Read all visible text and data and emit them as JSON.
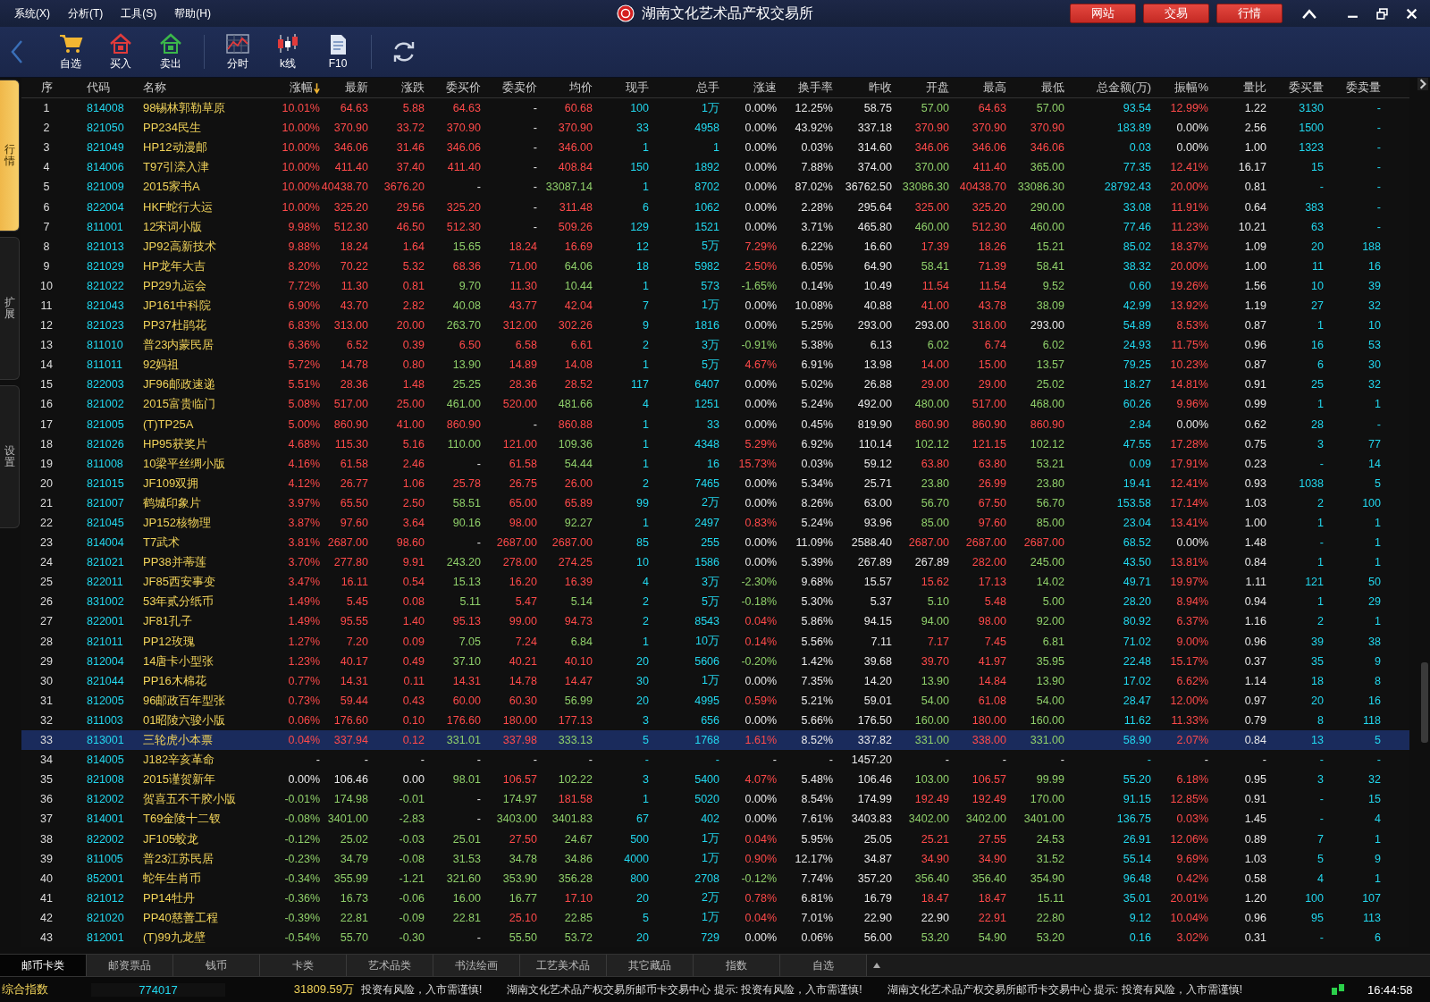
{
  "menu": [
    "系统(X)",
    "分析(T)",
    "工具(S)",
    "帮助(H)"
  ],
  "window": {
    "title": "湖南文化艺术品产权交易所",
    "buttons": [
      "网站",
      "交易",
      "行情"
    ]
  },
  "toolbar": [
    {
      "kind": "cart",
      "label": "自选"
    },
    {
      "kind": "buy",
      "label": "买入"
    },
    {
      "kind": "sell",
      "label": "卖出"
    },
    {
      "kind": "timeshare",
      "label": "分时"
    },
    {
      "kind": "kline",
      "label": "k线"
    },
    {
      "kind": "doc",
      "label": "F10"
    }
  ],
  "side_tabs": [
    {
      "label": "行情",
      "selected": true
    },
    {
      "label": "扩展",
      "selected": false
    },
    {
      "label": "设置",
      "selected": false
    }
  ],
  "table": {
    "columns": [
      {
        "label": "序",
        "kind": "seq",
        "sorted": false
      },
      {
        "label": "代码",
        "kind": "code",
        "sorted": false
      },
      {
        "label": "名称",
        "kind": "name",
        "sorted": false
      },
      {
        "label": "涨幅",
        "kind": "change",
        "sorted": true
      },
      {
        "label": "最新",
        "kind": "price",
        "sorted": false
      },
      {
        "label": "涨跌",
        "kind": "change",
        "sorted": false
      },
      {
        "label": "委买价",
        "kind": "price",
        "sorted": false
      },
      {
        "label": "委卖价",
        "kind": "price",
        "sorted": false
      },
      {
        "label": "均价",
        "kind": "price",
        "sorted": false
      },
      {
        "label": "现手",
        "kind": "volume",
        "sorted": false
      },
      {
        "label": "总手",
        "kind": "volume",
        "sorted": false
      },
      {
        "label": "涨速",
        "kind": "change",
        "sorted": false
      },
      {
        "label": "换手率",
        "kind": "plain",
        "sorted": false
      },
      {
        "label": "昨收",
        "kind": "prev_close",
        "sorted": false
      },
      {
        "label": "开盘",
        "kind": "price",
        "sorted": false
      },
      {
        "label": "最高",
        "kind": "price",
        "sorted": false
      },
      {
        "label": "最低",
        "kind": "price",
        "sorted": false
      },
      {
        "label": "总金额(万)",
        "kind": "volume",
        "sorted": false
      },
      {
        "label": "振幅%",
        "kind": "amplitude",
        "sorted": false
      },
      {
        "label": "量比",
        "kind": "plain",
        "sorted": false
      },
      {
        "label": "委买量",
        "kind": "volume",
        "sorted": false
      },
      {
        "label": "委卖量",
        "kind": "volume",
        "sorted": false
      }
    ],
    "rows": [
      {
        "selected": false,
        "cells": [
          "1",
          "814008",
          "98锡林郭勒草原",
          "10.01%",
          "64.63",
          "5.88",
          "64.63",
          "-",
          "60.68",
          "100",
          "1万",
          "0.00%",
          "12.25%",
          "58.75",
          "57.00",
          "64.63",
          "57.00",
          "93.54",
          "12.99%",
          "1.22",
          "3130",
          "-"
        ]
      },
      {
        "selected": false,
        "cells": [
          "2",
          "821050",
          "PP234民生",
          "10.00%",
          "370.90",
          "33.72",
          "370.90",
          "-",
          "370.90",
          "33",
          "4958",
          "0.00%",
          "43.92%",
          "337.18",
          "370.90",
          "370.90",
          "370.90",
          "183.89",
          "0.00%",
          "2.56",
          "1500",
          "-"
        ]
      },
      {
        "selected": false,
        "cells": [
          "3",
          "821049",
          "HP12动漫邮",
          "10.00%",
          "346.06",
          "31.46",
          "346.06",
          "-",
          "346.00",
          "1",
          "1",
          "0.00%",
          "0.03%",
          "314.60",
          "346.06",
          "346.06",
          "346.06",
          "0.03",
          "0.00%",
          "1.00",
          "1323",
          "-"
        ]
      },
      {
        "selected": false,
        "cells": [
          "4",
          "814006",
          "T97引滦入津",
          "10.00%",
          "411.40",
          "37.40",
          "411.40",
          "-",
          "408.84",
          "150",
          "1892",
          "0.00%",
          "7.88%",
          "374.00",
          "370.00",
          "411.40",
          "365.00",
          "77.35",
          "12.41%",
          "16.17",
          "15",
          "-"
        ]
      },
      {
        "selected": false,
        "cells": [
          "5",
          "821009",
          "2015家书A",
          "10.00%",
          "40438.70",
          "3676.20",
          "-",
          "-",
          "33087.14",
          "1",
          "8702",
          "0.00%",
          "87.02%",
          "36762.50",
          "33086.30",
          "40438.70",
          "33086.30",
          "28792.43",
          "20.00%",
          "0.81",
          "-",
          "-"
        ]
      },
      {
        "selected": false,
        "cells": [
          "6",
          "822004",
          "HKF蛇行大运",
          "10.00%",
          "325.20",
          "29.56",
          "325.20",
          "-",
          "311.48",
          "6",
          "1062",
          "0.00%",
          "2.28%",
          "295.64",
          "325.00",
          "325.20",
          "290.00",
          "33.08",
          "11.91%",
          "0.64",
          "383",
          "-"
        ]
      },
      {
        "selected": false,
        "cells": [
          "7",
          "811001",
          "12宋词小版",
          "9.98%",
          "512.30",
          "46.50",
          "512.30",
          "-",
          "509.26",
          "129",
          "1521",
          "0.00%",
          "3.71%",
          "465.80",
          "460.00",
          "512.30",
          "460.00",
          "77.46",
          "11.23%",
          "10.21",
          "63",
          "-"
        ]
      },
      {
        "selected": false,
        "cells": [
          "8",
          "821013",
          "JP92高新技术",
          "9.88%",
          "18.24",
          "1.64",
          "15.65",
          "18.24",
          "16.69",
          "12",
          "5万",
          "7.29%",
          "6.22%",
          "16.60",
          "17.39",
          "18.26",
          "15.21",
          "85.02",
          "18.37%",
          "1.09",
          "20",
          "188"
        ]
      },
      {
        "selected": false,
        "cells": [
          "9",
          "821029",
          "HP龙年大吉",
          "8.20%",
          "70.22",
          "5.32",
          "68.36",
          "71.00",
          "64.06",
          "18",
          "5982",
          "2.50%",
          "6.05%",
          "64.90",
          "58.41",
          "71.39",
          "58.41",
          "38.32",
          "20.00%",
          "1.00",
          "11",
          "16"
        ]
      },
      {
        "selected": false,
        "cells": [
          "10",
          "821022",
          "PP29九运会",
          "7.72%",
          "11.30",
          "0.81",
          "9.70",
          "11.30",
          "10.44",
          "1",
          "573",
          "-1.65%",
          "0.14%",
          "10.49",
          "11.54",
          "11.54",
          "9.52",
          "0.60",
          "19.26%",
          "1.56",
          "10",
          "39"
        ]
      },
      {
        "selected": false,
        "cells": [
          "11",
          "821043",
          "JP161中科院",
          "6.90%",
          "43.70",
          "2.82",
          "40.08",
          "43.77",
          "42.04",
          "7",
          "1万",
          "0.00%",
          "10.08%",
          "40.88",
          "41.00",
          "43.78",
          "38.09",
          "42.99",
          "13.92%",
          "1.19",
          "27",
          "32"
        ]
      },
      {
        "selected": false,
        "cells": [
          "12",
          "821023",
          "PP37杜鹃花",
          "6.83%",
          "313.00",
          "20.00",
          "263.70",
          "312.00",
          "302.26",
          "9",
          "1816",
          "0.00%",
          "5.25%",
          "293.00",
          "293.00",
          "318.00",
          "293.00",
          "54.89",
          "8.53%",
          "0.87",
          "1",
          "10"
        ]
      },
      {
        "selected": false,
        "cells": [
          "13",
          "811010",
          "普23内蒙民居",
          "6.36%",
          "6.52",
          "0.39",
          "6.50",
          "6.58",
          "6.61",
          "2",
          "3万",
          "-0.91%",
          "5.38%",
          "6.13",
          "6.02",
          "6.74",
          "6.02",
          "24.93",
          "11.75%",
          "0.96",
          "16",
          "53"
        ]
      },
      {
        "selected": false,
        "cells": [
          "14",
          "811011",
          "92妈祖",
          "5.72%",
          "14.78",
          "0.80",
          "13.90",
          "14.89",
          "14.08",
          "1",
          "5万",
          "4.67%",
          "6.91%",
          "13.98",
          "14.00",
          "15.00",
          "13.57",
          "79.25",
          "10.23%",
          "0.87",
          "6",
          "30"
        ]
      },
      {
        "selected": false,
        "cells": [
          "15",
          "822003",
          "JF96邮政速递",
          "5.51%",
          "28.36",
          "1.48",
          "25.25",
          "28.36",
          "28.52",
          "117",
          "6407",
          "0.00%",
          "5.02%",
          "26.88",
          "29.00",
          "29.00",
          "25.02",
          "18.27",
          "14.81%",
          "0.91",
          "25",
          "32"
        ]
      },
      {
        "selected": false,
        "cells": [
          "16",
          "821002",
          "2015富贵临门",
          "5.08%",
          "517.00",
          "25.00",
          "461.00",
          "520.00",
          "481.66",
          "4",
          "1251",
          "0.00%",
          "5.24%",
          "492.00",
          "480.00",
          "517.00",
          "468.00",
          "60.26",
          "9.96%",
          "0.99",
          "1",
          "1"
        ]
      },
      {
        "selected": false,
        "cells": [
          "17",
          "821005",
          "(T)TP25A",
          "5.00%",
          "860.90",
          "41.00",
          "860.90",
          "-",
          "860.88",
          "1",
          "33",
          "0.00%",
          "0.45%",
          "819.90",
          "860.90",
          "860.90",
          "860.90",
          "2.84",
          "0.00%",
          "0.62",
          "28",
          "-"
        ]
      },
      {
        "selected": false,
        "cells": [
          "18",
          "821026",
          "HP95获奖片",
          "4.68%",
          "115.30",
          "5.16",
          "110.00",
          "121.00",
          "109.36",
          "1",
          "4348",
          "5.29%",
          "6.92%",
          "110.14",
          "102.12",
          "121.15",
          "102.12",
          "47.55",
          "17.28%",
          "0.75",
          "3",
          "77"
        ]
      },
      {
        "selected": false,
        "cells": [
          "19",
          "811008",
          "10梁平丝绸小版",
          "4.16%",
          "61.58",
          "2.46",
          "-",
          "61.58",
          "54.44",
          "1",
          "16",
          "15.73%",
          "0.03%",
          "59.12",
          "63.80",
          "63.80",
          "53.21",
          "0.09",
          "17.91%",
          "0.23",
          "-",
          "14"
        ]
      },
      {
        "selected": false,
        "cells": [
          "20",
          "821015",
          "JF109双拥",
          "4.12%",
          "26.77",
          "1.06",
          "25.78",
          "26.75",
          "26.00",
          "2",
          "7465",
          "0.00%",
          "5.34%",
          "25.71",
          "23.80",
          "26.99",
          "23.80",
          "19.41",
          "12.41%",
          "0.93",
          "1038",
          "5"
        ]
      },
      {
        "selected": false,
        "cells": [
          "21",
          "821007",
          "鹤城印象片",
          "3.97%",
          "65.50",
          "2.50",
          "58.51",
          "65.00",
          "65.89",
          "99",
          "2万",
          "0.00%",
          "8.26%",
          "63.00",
          "56.70",
          "67.50",
          "56.70",
          "153.58",
          "17.14%",
          "1.03",
          "2",
          "100"
        ]
      },
      {
        "selected": false,
        "cells": [
          "22",
          "821045",
          "JP152核物理",
          "3.87%",
          "97.60",
          "3.64",
          "90.16",
          "98.00",
          "92.27",
          "1",
          "2497",
          "0.83%",
          "5.24%",
          "93.96",
          "85.00",
          "97.60",
          "85.00",
          "23.04",
          "13.41%",
          "1.00",
          "1",
          "1"
        ]
      },
      {
        "selected": false,
        "cells": [
          "23",
          "814004",
          "T7武术",
          "3.81%",
          "2687.00",
          "98.60",
          "-",
          "2687.00",
          "2687.00",
          "85",
          "255",
          "0.00%",
          "11.09%",
          "2588.40",
          "2687.00",
          "2687.00",
          "2687.00",
          "68.52",
          "0.00%",
          "1.48",
          "-",
          "1"
        ]
      },
      {
        "selected": false,
        "cells": [
          "24",
          "821021",
          "PP38并蒂莲",
          "3.70%",
          "277.80",
          "9.91",
          "243.20",
          "278.00",
          "274.25",
          "10",
          "1586",
          "0.00%",
          "5.39%",
          "267.89",
          "267.89",
          "282.00",
          "245.00",
          "43.50",
          "13.81%",
          "0.84",
          "1",
          "1"
        ]
      },
      {
        "selected": false,
        "cells": [
          "25",
          "822011",
          "JF85西安事变",
          "3.47%",
          "16.11",
          "0.54",
          "15.13",
          "16.20",
          "16.39",
          "4",
          "3万",
          "-2.30%",
          "9.68%",
          "15.57",
          "15.62",
          "17.13",
          "14.02",
          "49.71",
          "19.97%",
          "1.11",
          "121",
          "50"
        ]
      },
      {
        "selected": false,
        "cells": [
          "26",
          "831002",
          "53年贰分纸币",
          "1.49%",
          "5.45",
          "0.08",
          "5.11",
          "5.47",
          "5.14",
          "2",
          "5万",
          "-0.18%",
          "5.30%",
          "5.37",
          "5.10",
          "5.48",
          "5.00",
          "28.20",
          "8.94%",
          "0.94",
          "1",
          "29"
        ]
      },
      {
        "selected": false,
        "cells": [
          "27",
          "822001",
          "JF81孔子",
          "1.49%",
          "95.55",
          "1.40",
          "95.13",
          "99.00",
          "94.73",
          "2",
          "8543",
          "0.04%",
          "5.86%",
          "94.15",
          "94.00",
          "98.00",
          "92.00",
          "80.92",
          "6.37%",
          "1.16",
          "2",
          "1"
        ]
      },
      {
        "selected": false,
        "cells": [
          "28",
          "821011",
          "PP12玫瑰",
          "1.27%",
          "7.20",
          "0.09",
          "7.05",
          "7.24",
          "6.84",
          "1",
          "10万",
          "0.14%",
          "5.56%",
          "7.11",
          "7.17",
          "7.45",
          "6.81",
          "71.02",
          "9.00%",
          "0.96",
          "39",
          "38"
        ]
      },
      {
        "selected": false,
        "cells": [
          "29",
          "812004",
          "14唐卡小型张",
          "1.23%",
          "40.17",
          "0.49",
          "37.10",
          "40.21",
          "40.10",
          "20",
          "5606",
          "-0.20%",
          "1.42%",
          "39.68",
          "39.70",
          "41.97",
          "35.95",
          "22.48",
          "15.17%",
          "0.37",
          "35",
          "9"
        ]
      },
      {
        "selected": false,
        "cells": [
          "30",
          "821044",
          "PP16木棉花",
          "0.77%",
          "14.31",
          "0.11",
          "14.31",
          "14.78",
          "14.47",
          "30",
          "1万",
          "0.00%",
          "7.35%",
          "14.20",
          "13.90",
          "14.84",
          "13.90",
          "17.02",
          "6.62%",
          "1.14",
          "18",
          "8"
        ]
      },
      {
        "selected": false,
        "cells": [
          "31",
          "812005",
          "96邮政百年型张",
          "0.73%",
          "59.44",
          "0.43",
          "60.00",
          "60.30",
          "56.99",
          "20",
          "4995",
          "0.59%",
          "5.21%",
          "59.01",
          "54.00",
          "61.08",
          "54.00",
          "28.47",
          "12.00%",
          "0.97",
          "20",
          "16"
        ]
      },
      {
        "selected": false,
        "cells": [
          "32",
          "811003",
          "01昭陵六骏小版",
          "0.06%",
          "176.60",
          "0.10",
          "176.60",
          "180.00",
          "177.13",
          "3",
          "656",
          "0.00%",
          "5.66%",
          "176.50",
          "160.00",
          "180.00",
          "160.00",
          "11.62",
          "11.33%",
          "0.79",
          "8",
          "118"
        ]
      },
      {
        "selected": true,
        "cells": [
          "33",
          "813001",
          "三轮虎小本票",
          "0.04%",
          "337.94",
          "0.12",
          "331.01",
          "337.98",
          "333.13",
          "5",
          "1768",
          "1.61%",
          "8.52%",
          "337.82",
          "331.00",
          "338.00",
          "331.00",
          "58.90",
          "2.07%",
          "0.84",
          "13",
          "5"
        ]
      },
      {
        "selected": false,
        "cells": [
          "34",
          "814005",
          "J182辛亥革命",
          "-",
          "-",
          "-",
          "-",
          "-",
          "-",
          "-",
          "-",
          "-",
          "-",
          "1457.20",
          "-",
          "-",
          "-",
          "-",
          "-",
          "-",
          "-",
          "-"
        ]
      },
      {
        "selected": false,
        "cells": [
          "35",
          "821008",
          "2015谨贺新年",
          "0.00%",
          "106.46",
          "0.00",
          "98.01",
          "106.57",
          "102.22",
          "3",
          "5400",
          "4.07%",
          "5.48%",
          "106.46",
          "103.00",
          "106.57",
          "99.99",
          "55.20",
          "6.18%",
          "0.95",
          "3",
          "32"
        ]
      },
      {
        "selected": false,
        "cells": [
          "36",
          "812002",
          "贺喜五不干胶小版",
          "-0.01%",
          "174.98",
          "-0.01",
          "-",
          "174.97",
          "181.58",
          "1",
          "5020",
          "0.00%",
          "8.54%",
          "174.99",
          "192.49",
          "192.49",
          "170.00",
          "91.15",
          "12.85%",
          "0.91",
          "-",
          "15"
        ]
      },
      {
        "selected": false,
        "cells": [
          "37",
          "814001",
          "T69金陵十二钗",
          "-0.08%",
          "3401.00",
          "-2.83",
          "-",
          "3403.00",
          "3401.83",
          "67",
          "402",
          "0.00%",
          "7.61%",
          "3403.83",
          "3402.00",
          "3402.00",
          "3401.00",
          "136.75",
          "0.03%",
          "1.45",
          "-",
          "4"
        ]
      },
      {
        "selected": false,
        "cells": [
          "38",
          "822002",
          "JF105蛟龙",
          "-0.12%",
          "25.02",
          "-0.03",
          "25.01",
          "27.50",
          "24.67",
          "500",
          "1万",
          "0.04%",
          "5.95%",
          "25.05",
          "25.21",
          "27.55",
          "24.53",
          "26.91",
          "12.06%",
          "0.89",
          "7",
          "1"
        ]
      },
      {
        "selected": false,
        "cells": [
          "39",
          "811005",
          "普23江苏民居",
          "-0.23%",
          "34.79",
          "-0.08",
          "31.53",
          "34.78",
          "34.86",
          "4000",
          "1万",
          "0.90%",
          "12.17%",
          "34.87",
          "34.90",
          "34.90",
          "31.52",
          "55.14",
          "9.69%",
          "1.03",
          "5",
          "9"
        ]
      },
      {
        "selected": false,
        "cells": [
          "40",
          "852001",
          "蛇年生肖币",
          "-0.34%",
          "355.99",
          "-1.21",
          "321.60",
          "353.90",
          "356.28",
          "800",
          "2708",
          "-0.12%",
          "7.74%",
          "357.20",
          "356.40",
          "356.40",
          "354.90",
          "96.48",
          "0.42%",
          "0.58",
          "4",
          "1"
        ]
      },
      {
        "selected": false,
        "cells": [
          "41",
          "821012",
          "PP14牡丹",
          "-0.36%",
          "16.73",
          "-0.06",
          "16.00",
          "16.77",
          "17.10",
          "20",
          "2万",
          "0.78%",
          "6.81%",
          "16.79",
          "18.47",
          "18.47",
          "15.11",
          "35.01",
          "20.01%",
          "1.20",
          "100",
          "107"
        ]
      },
      {
        "selected": false,
        "cells": [
          "42",
          "821020",
          "PP40慈善工程",
          "-0.39%",
          "22.81",
          "-0.09",
          "22.81",
          "25.10",
          "22.85",
          "5",
          "1万",
          "0.04%",
          "7.01%",
          "22.90",
          "22.90",
          "22.91",
          "22.80",
          "9.12",
          "10.04%",
          "0.96",
          "95",
          "113"
        ]
      },
      {
        "selected": false,
        "cells": [
          "43",
          "812001",
          "(T)99九龙壁",
          "-0.54%",
          "55.70",
          "-0.30",
          "-",
          "55.50",
          "53.72",
          "20",
          "729",
          "0.00%",
          "0.06%",
          "56.00",
          "53.20",
          "54.90",
          "53.20",
          "0.16",
          "3.02%",
          "0.31",
          "-",
          "6"
        ]
      }
    ]
  },
  "bottom_tabs": [
    {
      "label": "邮币卡类",
      "selected": true
    },
    {
      "label": "邮资票品",
      "selected": false
    },
    {
      "label": "钱币",
      "selected": false
    },
    {
      "label": "卡类",
      "selected": false
    },
    {
      "label": "艺术品类",
      "selected": false
    },
    {
      "label": "书法绘画",
      "selected": false
    },
    {
      "label": "工艺美术品",
      "selected": false
    },
    {
      "label": "其它藏品",
      "selected": false
    },
    {
      "label": "指数",
      "selected": false
    },
    {
      "label": "自选",
      "selected": false
    }
  ],
  "status_bar": {
    "index_name": "综合指数",
    "volume": "774017",
    "amount": "31809.59万",
    "messages": [
      "投资有风险，入市需谨慎!",
      "湖南文化艺术品产权交易所邮币卡交易中心  提示:  投资有风险，入市需谨慎!",
      "湖南文化艺术品产权交易所邮币卡交易中心  提示:  投资有风险，入市需谨慎!"
    ],
    "time": "16:44:58"
  }
}
